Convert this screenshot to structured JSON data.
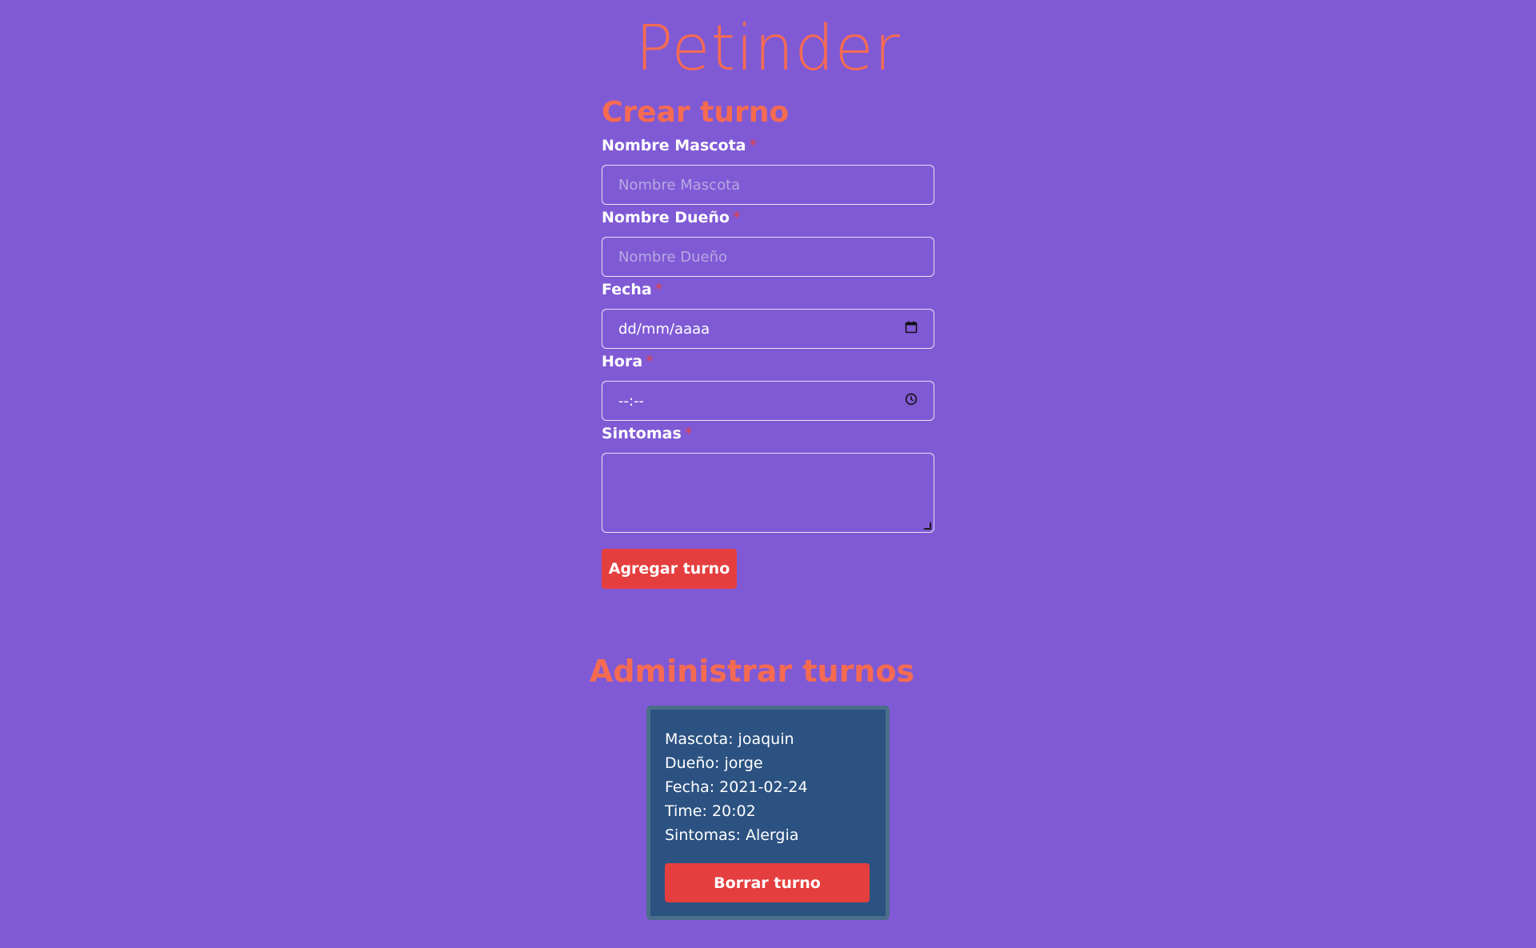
{
  "app": {
    "title": "Petinder"
  },
  "form": {
    "title": "Crear turno",
    "fields": [
      {
        "label": "Nombre Mascota",
        "required_mark": "*",
        "placeholder": "Nombre Mascota",
        "value": ""
      },
      {
        "label": "Nombre Dueño",
        "required_mark": "*",
        "placeholder": "Nombre Dueño",
        "value": ""
      },
      {
        "label": "Fecha",
        "required_mark": "*",
        "placeholder": "dd/mm/aaaa",
        "value": "",
        "icon": "calendar-icon"
      },
      {
        "label": "Hora",
        "required_mark": "*",
        "placeholder": "--:--",
        "value": "",
        "icon": "clock-icon"
      },
      {
        "label": "Sintomas",
        "required_mark": "*",
        "value": ""
      }
    ],
    "submit_label": "Agregar turno"
  },
  "admin": {
    "title": "Administrar turnos",
    "appointments": [
      {
        "mascota": "Mascota: joaquin",
        "dueno": "Dueño: jorge",
        "fecha": "Fecha: 2021-02-24",
        "time": "Time: 20:02",
        "sintomas": "Sintomas: Alergia",
        "delete_label": "Borrar turno"
      }
    ]
  },
  "colors": {
    "background": "#805ad5",
    "accent_title": "#f56b52",
    "button": "#e53e3e",
    "card_bg": "#2c5282"
  }
}
